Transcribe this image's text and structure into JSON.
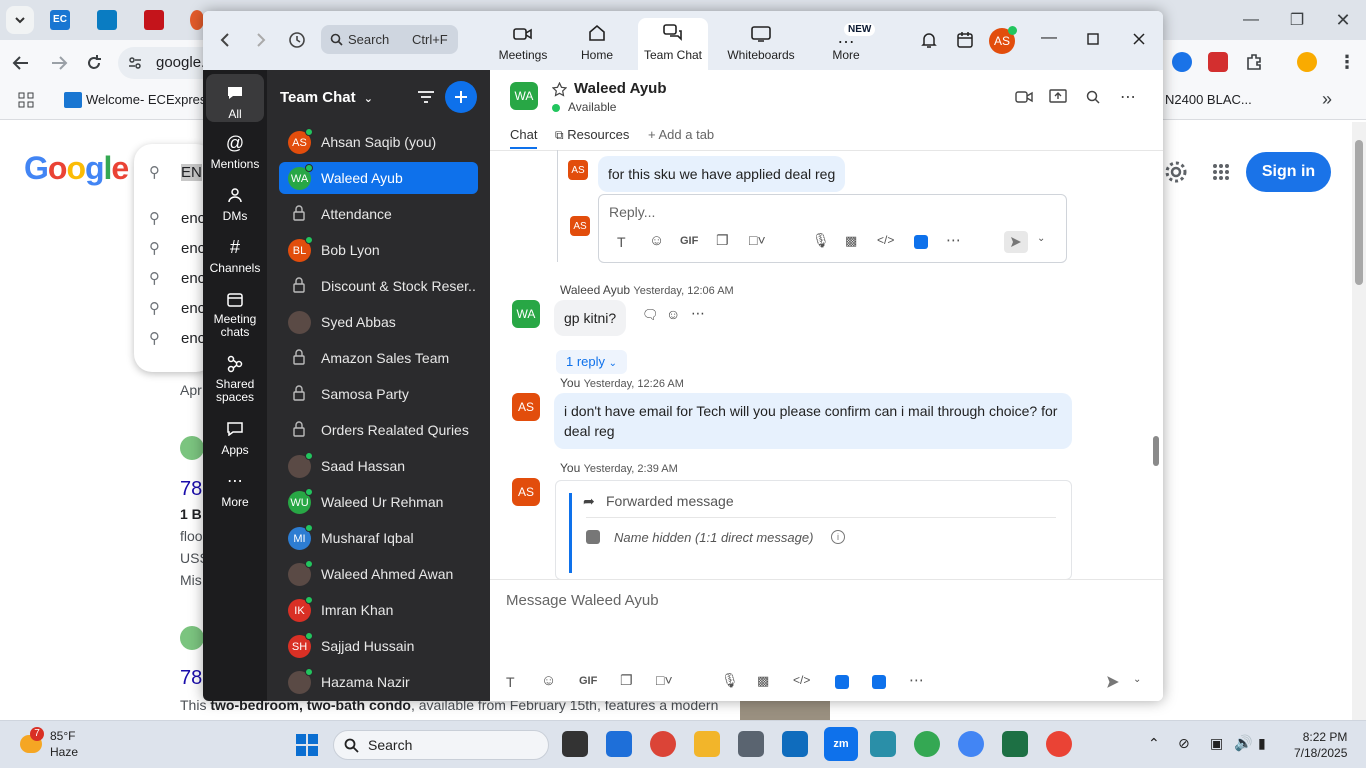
{
  "browser": {
    "omnibox_text": "google.",
    "bookmark_1": "Welcome- ECExpres...",
    "bookmark_2": "N2400 BLAC...",
    "google_logo": "Google",
    "search_value": "EN",
    "suggestions": [
      "enc",
      "enc",
      "enc",
      "enc",
      "enc"
    ],
    "snippet_apr": "Apr",
    "price_1": "78",
    "price_2": "78",
    "b1": "1 B",
    "floo": "floo",
    "uss": "USS",
    "mis": "Mis",
    "condo_text_1": "This ",
    "condo_text_bold": "two-bedroom, two-bath condo",
    "condo_text_2": ", available from February 15th, features a modern",
    "sign_in": "Sign in"
  },
  "zoom": {
    "search_label": "Search",
    "search_shortcut": "Ctrl+F",
    "tabs": [
      {
        "label": "Meetings",
        "icon": "video-camera-icon"
      },
      {
        "label": "Home",
        "icon": "home-icon"
      },
      {
        "label": "Team Chat",
        "icon": "chat-bubbles-icon"
      },
      {
        "label": "Whiteboards",
        "icon": "whiteboard-icon"
      },
      {
        "label": "More",
        "icon": "ellipsis-icon"
      }
    ],
    "new_badge": "NEW",
    "user_initials": "AS",
    "rail": [
      {
        "label": "All"
      },
      {
        "label": "Mentions"
      },
      {
        "label": "DMs"
      },
      {
        "label": "Channels"
      },
      {
        "label": "Meeting chats"
      },
      {
        "label": "Shared spaces"
      },
      {
        "label": "Apps"
      },
      {
        "label": "More"
      }
    ],
    "list_title": "Team Chat",
    "contacts": [
      {
        "initials": "AS",
        "name": "Ahsan Saqib (you)",
        "color": "#e24d0c"
      },
      {
        "initials": "WA",
        "name": "Waleed Ayub",
        "color": "#28a745"
      },
      {
        "initials": "",
        "name": "Attendance"
      },
      {
        "initials": "BL",
        "name": "Bob Lyon",
        "color": "#e24d0c"
      },
      {
        "initials": "",
        "name": "Discount & Stock Reser..."
      },
      {
        "initials": "",
        "name": "Syed Abbas"
      },
      {
        "initials": "",
        "name": "Amazon Sales Team"
      },
      {
        "initials": "",
        "name": "Samosa Party"
      },
      {
        "initials": "",
        "name": "Orders Realated Quries"
      },
      {
        "initials": "",
        "name": "Saad Hassan"
      },
      {
        "initials": "WU",
        "name": "Waleed Ur Rehman",
        "color": "#28a745"
      },
      {
        "initials": "MI",
        "name": "Musharaf Iqbal",
        "color": "#2d7dd2"
      },
      {
        "initials": "",
        "name": "Waleed Ahmed Awan"
      },
      {
        "initials": "IK",
        "name": "Imran Khan",
        "color": "#d93025"
      },
      {
        "initials": "SH",
        "name": "Sajjad Hussain",
        "color": "#d93025"
      },
      {
        "initials": "",
        "name": "Hazama Nazir"
      }
    ],
    "conversation": {
      "initials": "WA",
      "name": "Waleed Ayub",
      "status": "Available",
      "tabs": [
        "Chat",
        "Resources",
        "Add a tab"
      ],
      "thread_msg": "for this sku we have applied deal reg",
      "thread_initials": "AS",
      "reply_placeholder": "Reply...",
      "gif": "GIF",
      "msg1_sender": "Waleed Ayub",
      "msg1_time": "Yesterday, 12:06 AM",
      "msg1_text": "gp kitni?",
      "msg1_replies": "1 reply",
      "msg2_sender": "You",
      "msg2_time": "Yesterday, 12:26 AM",
      "msg2_text": "i don't have email for Tech will you please confirm can i mail through choice? for deal reg",
      "msg3_sender": "You",
      "msg3_time": "Yesterday, 2:39 AM",
      "forwarded_label": "Forwarded message",
      "forwarded_from": "Name hidden (1:1 direct message)",
      "composer_placeholder": "Message Waleed Ayub"
    }
  },
  "taskbar": {
    "weather_badge": "7",
    "temp": "85°F",
    "condition": "Haze",
    "search_label": "Search",
    "time": "8:22 PM",
    "date": "7/18/2025"
  },
  "colors": {
    "zoom_blue": "#0e71eb",
    "avatar_orange": "#e24d0c",
    "avatar_green": "#28a745",
    "online_green": "#22c55e",
    "chat_list_bg": "#2b2b2d"
  }
}
